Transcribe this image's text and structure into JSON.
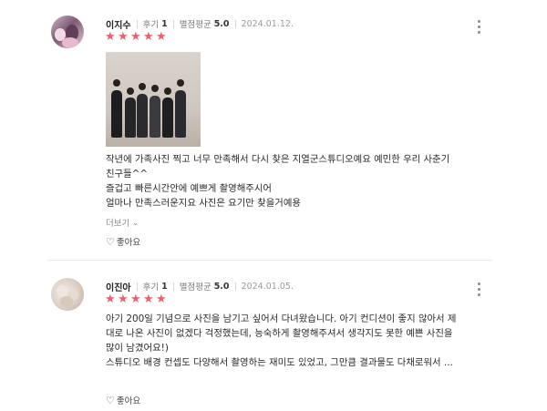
{
  "reviews": [
    {
      "author": "이지수",
      "review_label": "후기",
      "review_count": "1",
      "rating_label": "별점평균",
      "rating_avg": "5.0",
      "date": "2024.01.12.",
      "rating": 5,
      "has_photo": true,
      "lines": [
        "작년에 가족사진 찍고 너무 만족해서 다시 찾은 지열군스튜디오예요 예민한 우리 사춘기",
        "친구들^^",
        "즐겁고 빠른시간안에 예쁘게 촬영해주시어",
        "얼마나 만족스러운지요 사진은 요기만 찾을거예용"
      ],
      "more_label": "더보기",
      "like_label": "좋아요"
    },
    {
      "author": "이진아",
      "review_label": "후기",
      "review_count": "1",
      "rating_label": "별점평균",
      "rating_avg": "5.0",
      "date": "2024.01.05.",
      "rating": 5,
      "has_photo": false,
      "lines": [
        "아기 200일 기념으로 사진을 남기고 싶어서 다녀왔습니다. 아기 컨디션이 좋지 않아서 제",
        "대로 나온 사진이 없겠다 걱정했는데, 능숙하게 촬영해주셔서 생각지도 못한 예쁜 사진을",
        "많이 남겼어요!)",
        "스튜디오 배경 컨셉도 다양해서 촬영하는 재미도 있었고, 그만큼 결과물도 다채로워서 ..."
      ],
      "like_label": "좋아요"
    }
  ],
  "colors": {
    "star": "#f25c6b",
    "meta_gray": "#7a7a7a",
    "divider": "#ebebeb"
  },
  "icons": {
    "star": "star-icon",
    "more": "kebab-menu-icon",
    "heart": "heart-outline-icon",
    "chevron": "chevron-down-icon"
  }
}
